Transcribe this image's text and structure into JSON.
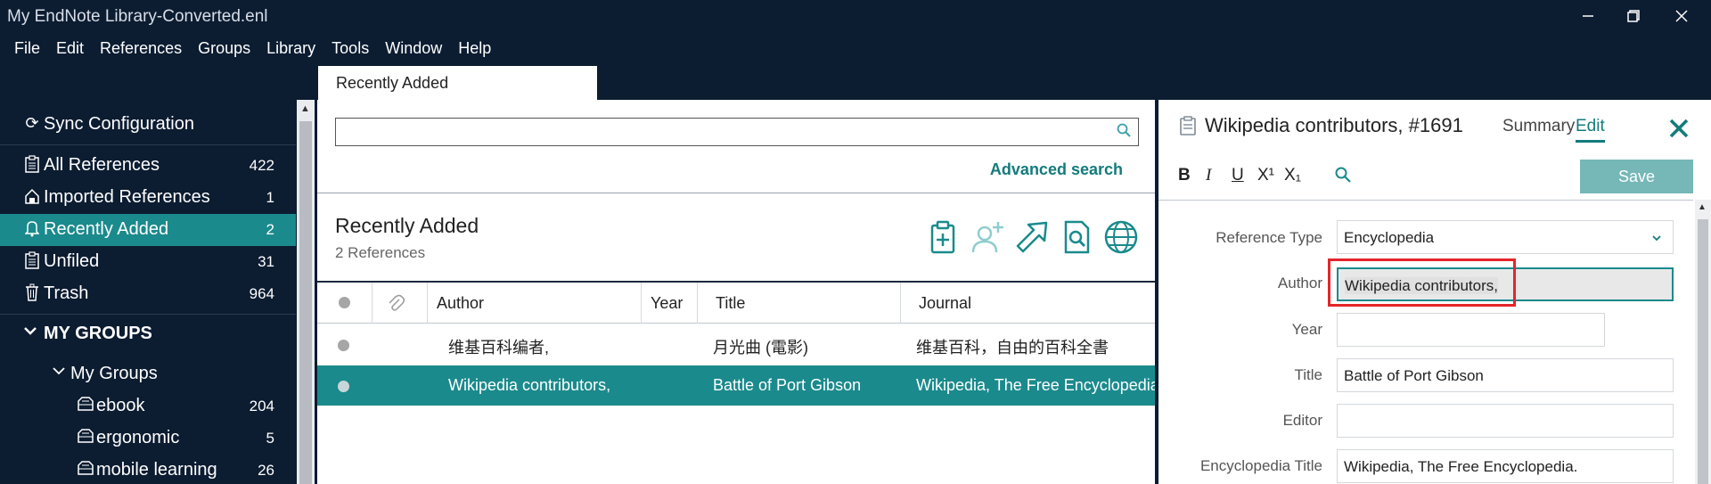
{
  "window": {
    "title": "My EndNote Library-Converted.enl"
  },
  "menu": [
    "File",
    "Edit",
    "References",
    "Groups",
    "Library",
    "Tools",
    "Window",
    "Help"
  ],
  "sidebar": {
    "sync": "Sync Configuration",
    "items": [
      {
        "label": "All References",
        "count": "422"
      },
      {
        "label": "Imported References",
        "count": "1"
      },
      {
        "label": "Recently Added",
        "count": "2"
      },
      {
        "label": "Unfiled",
        "count": "31"
      },
      {
        "label": "Trash",
        "count": "964"
      }
    ],
    "my_groups_header": "MY GROUPS",
    "my_groups_sub": "My Groups",
    "groups": [
      {
        "label": "ebook",
        "count": "204"
      },
      {
        "label": "ergonomic",
        "count": "5"
      },
      {
        "label": "mobile learning",
        "count": "26"
      }
    ]
  },
  "tab": {
    "label": "Recently Added"
  },
  "middle": {
    "search_placeholder": "",
    "advanced_search": "Advanced search",
    "title": "Recently Added",
    "count": "2 References",
    "columns": {
      "author": "Author",
      "year": "Year",
      "title": "Title",
      "journal": "Journal"
    },
    "rows": [
      {
        "author": "维基百科编者,",
        "year": "",
        "title": "月光曲 (電影)",
        "journal": "维基百科，自由的百科全書"
      },
      {
        "author": "Wikipedia contributors,",
        "year": "",
        "title": "Battle of Port Gibson",
        "journal": "Wikipedia, The Free Encyclopedia."
      }
    ]
  },
  "right": {
    "header_title": "Wikipedia contributors,  #1691",
    "summary_tab": "Summary",
    "edit_tab": "Edit",
    "format": {
      "bold": "B",
      "italic": "I",
      "underline": "U",
      "superscript": "X¹",
      "subscript": "X₁"
    },
    "save": "Save",
    "fields": [
      {
        "label": "Reference Type",
        "value": "Encyclopedia"
      },
      {
        "label": "Author",
        "value": "Wikipedia contributors,"
      },
      {
        "label": "Year",
        "value": ""
      },
      {
        "label": "Title",
        "value": "Battle of Port Gibson"
      },
      {
        "label": "Editor",
        "value": ""
      },
      {
        "label": "Encyclopedia Title",
        "value": "Wikipedia, The Free Encyclopedia."
      }
    ]
  }
}
